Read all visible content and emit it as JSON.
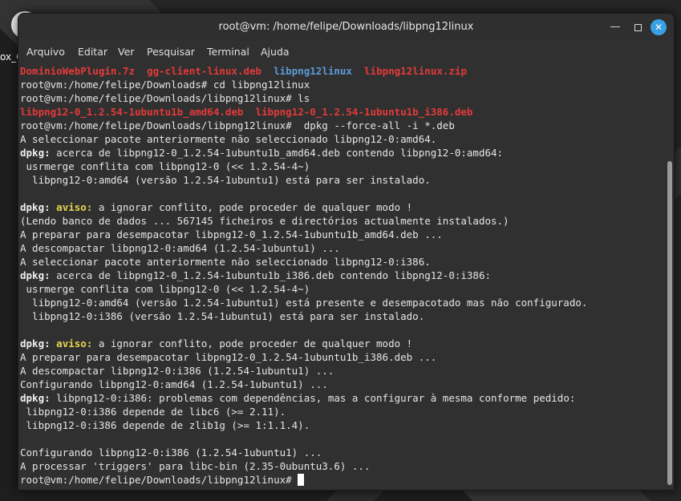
{
  "desktop": {
    "icon_label": "ox_C"
  },
  "window": {
    "title": "root@vm: /home/felipe/Downloads/libpng12linux",
    "controls": {
      "minimize": "—",
      "close": "✕"
    }
  },
  "menu": [
    "Arquivo",
    "Editar",
    "Ver",
    "Pesquisar",
    "Terminal",
    "Ajuda"
  ],
  "terminal": {
    "lines": [
      [
        {
          "t": "DominioWebPlugin.7z",
          "c": "red"
        },
        {
          "t": "  "
        },
        {
          "t": "gg-client-linux.deb",
          "c": "red"
        },
        {
          "t": "  "
        },
        {
          "t": "libpng12linux",
          "c": "blue"
        },
        {
          "t": "  "
        },
        {
          "t": "libpng12linux.zip",
          "c": "red"
        }
      ],
      [
        {
          "t": "root@vm:/home/felipe/Downloads# cd libpng12linux"
        }
      ],
      [
        {
          "t": "root@vm:/home/felipe/Downloads/libpng12linux# ls"
        }
      ],
      [
        {
          "t": "libpng12-0_1.2.54-1ubuntu1b_amd64.deb",
          "c": "red"
        },
        {
          "t": "  "
        },
        {
          "t": "libpng12-0_1.2.54-1ubuntu1b_i386.deb",
          "c": "red"
        }
      ],
      [
        {
          "t": "root@vm:/home/felipe/Downloads/libpng12linux#  dpkg --force-all -i *.deb"
        }
      ],
      [
        {
          "t": "A seleccionar pacote anteriormente não seleccionado libpng12-0:amd64."
        }
      ],
      [
        {
          "t": "dpkg:",
          "c": "bold"
        },
        {
          "t": " acerca de libpng12-0_1.2.54-1ubuntu1b_amd64.deb contendo libpng12-0:amd64:"
        }
      ],
      [
        {
          "t": " usrmerge conflita com libpng12-0 (<< 1.2.54-4~)"
        }
      ],
      [
        {
          "t": "  libpng12-0:amd64 (versão 1.2.54-1ubuntu1) está para ser instalado."
        }
      ],
      [
        {
          "t": ""
        }
      ],
      [
        {
          "t": "dpkg:",
          "c": "bold"
        },
        {
          "t": " "
        },
        {
          "t": "aviso:",
          "c": "yel"
        },
        {
          "t": " a ignorar conflito, pode proceder de qualquer modo !"
        }
      ],
      [
        {
          "t": "(Lendo banco de dados ... 567145 ficheiros e directórios actualmente instalados.)"
        }
      ],
      [
        {
          "t": "A preparar para desempacotar libpng12-0_1.2.54-1ubuntu1b_amd64.deb ..."
        }
      ],
      [
        {
          "t": "A descompactar libpng12-0:amd64 (1.2.54-1ubuntu1) ..."
        }
      ],
      [
        {
          "t": "A seleccionar pacote anteriormente não seleccionado libpng12-0:i386."
        }
      ],
      [
        {
          "t": "dpkg:",
          "c": "bold"
        },
        {
          "t": " acerca de libpng12-0_1.2.54-1ubuntu1b_i386.deb contendo libpng12-0:i386:"
        }
      ],
      [
        {
          "t": " usrmerge conflita com libpng12-0 (<< 1.2.54-4~)"
        }
      ],
      [
        {
          "t": "  libpng12-0:amd64 (versão 1.2.54-1ubuntu1) está presente e desempacotado mas não configurado."
        }
      ],
      [
        {
          "t": "  libpng12-0:i386 (versão 1.2.54-1ubuntu1) está para ser instalado."
        }
      ],
      [
        {
          "t": ""
        }
      ],
      [
        {
          "t": "dpkg:",
          "c": "bold"
        },
        {
          "t": " "
        },
        {
          "t": "aviso:",
          "c": "yel"
        },
        {
          "t": " a ignorar conflito, pode proceder de qualquer modo !"
        }
      ],
      [
        {
          "t": "A preparar para desempacotar libpng12-0_1.2.54-1ubuntu1b_i386.deb ..."
        }
      ],
      [
        {
          "t": "A descompactar libpng12-0:i386 (1.2.54-1ubuntu1) ..."
        }
      ],
      [
        {
          "t": "Configurando libpng12-0:amd64 (1.2.54-1ubuntu1) ..."
        }
      ],
      [
        {
          "t": "dpkg:",
          "c": "bold"
        },
        {
          "t": " libpng12-0:i386: problemas com dependências, mas a configurar à mesma conforme pedido:"
        }
      ],
      [
        {
          "t": " libpng12-0:i386 depende de libc6 (>= 2.11)."
        }
      ],
      [
        {
          "t": " libpng12-0:i386 depende de zlib1g (>= 1:1.1.4)."
        }
      ],
      [
        {
          "t": ""
        }
      ],
      [
        {
          "t": "Configurando libpng12-0:i386 (1.2.54-1ubuntu1) ..."
        }
      ],
      [
        {
          "t": "A processar 'triggers' para libc-bin (2.35-0ubuntu3.6) ..."
        }
      ],
      [
        {
          "t": "root@vm:/home/felipe/Downloads/libpng12linux# "
        }
      ]
    ]
  },
  "colors": {
    "error_file": "#e33a3a",
    "directory": "#5b9bd5",
    "warning": "#e8d44d",
    "close_button": "#3aa0e6"
  }
}
